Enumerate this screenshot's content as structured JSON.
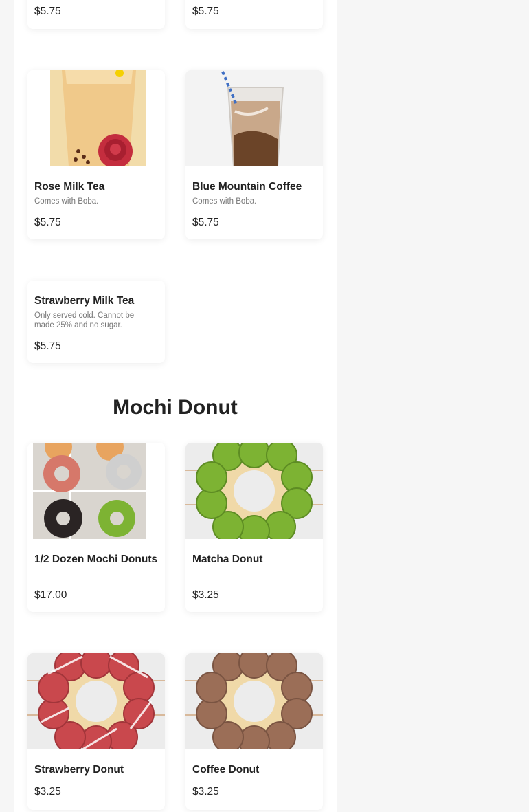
{
  "top_prices": {
    "left": "$5.75",
    "right": "$5.75"
  },
  "items": [
    {
      "name": "Rose Milk Tea",
      "desc": "Comes with Boba.",
      "price": "$5.75"
    },
    {
      "name": "Blue Mountain Coffee",
      "desc": "Comes with Boba.",
      "price": "$5.75"
    },
    {
      "name": "Strawberry Milk Tea",
      "desc": "Only served cold. Cannot be made 25% and no sugar.",
      "price": "$5.75"
    }
  ],
  "section": {
    "title": "Mochi Donut"
  },
  "donuts": [
    {
      "name": "1/2 Dozen Mochi Donuts",
      "price": "$17.00"
    },
    {
      "name": "Matcha Donut",
      "price": "$3.25"
    },
    {
      "name": "Strawberry Donut",
      "price": "$3.25"
    },
    {
      "name": "Coffee Donut",
      "price": "$3.25"
    }
  ],
  "colors": {
    "matcha": "#7db333",
    "strawberry": "#c9484d",
    "coffee": "#9b6e57",
    "rose": "#c42d3e"
  }
}
